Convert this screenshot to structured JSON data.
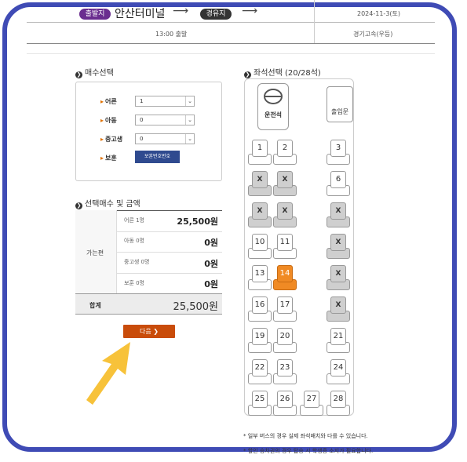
{
  "header": {
    "departure_tag": "출발지",
    "departure_name": "안산터미널",
    "via_tag": "경유지",
    "date": "2024-11-3(토)",
    "time": "13:00 출발",
    "bus_company": "경기고속(우등)"
  },
  "ticket_select": {
    "title": "매수선택",
    "rows": [
      {
        "label": "어른",
        "value": "1"
      },
      {
        "label": "아동",
        "value": "0"
      },
      {
        "label": "중고생",
        "value": "0"
      }
    ],
    "veteran_label": "보훈",
    "veteran_button": "보훈번호번호"
  },
  "summary": {
    "title": "선택매수 및 금액",
    "group_label": "가는편",
    "lines": [
      {
        "label": "어른 1명",
        "amount": "25,500원"
      },
      {
        "label": "아동 0명",
        "amount": "0원"
      },
      {
        "label": "중고생 0명",
        "amount": "0원"
      },
      {
        "label": "보훈 0명",
        "amount": "0원"
      }
    ],
    "total_label": "합계",
    "total_amount": "25,500원",
    "next_button": "다음 ❯"
  },
  "seats": {
    "title": "좌석선택 (20/28석)",
    "driver_label": "운전석",
    "door_label": "출입문",
    "taken_mark": "X",
    "notes": [
      "* 일부 버스의 경우 실제 좌석배치와 다를 수 있습니다.",
      "* 할인 승차권의 경우 탑승 시 학생증 소지가 필요합니다."
    ],
    "layout": [
      {
        "id": "1",
        "state": "free"
      },
      {
        "id": "2",
        "state": "free"
      },
      {
        "id": "3",
        "state": "free"
      },
      {
        "id": "4",
        "state": "taken"
      },
      {
        "id": "5",
        "state": "taken"
      },
      {
        "id": "6",
        "state": "free"
      },
      {
        "id": "7",
        "state": "taken"
      },
      {
        "id": "8",
        "state": "taken"
      },
      {
        "id": "9",
        "state": "taken"
      },
      {
        "id": "10",
        "state": "free"
      },
      {
        "id": "11",
        "state": "free"
      },
      {
        "id": "12",
        "state": "taken"
      },
      {
        "id": "13",
        "state": "free"
      },
      {
        "id": "14",
        "state": "selected"
      },
      {
        "id": "15",
        "state": "taken"
      },
      {
        "id": "16",
        "state": "free"
      },
      {
        "id": "17",
        "state": "free"
      },
      {
        "id": "18",
        "state": "taken"
      },
      {
        "id": "19",
        "state": "free"
      },
      {
        "id": "20",
        "state": "free"
      },
      {
        "id": "21",
        "state": "free"
      },
      {
        "id": "22",
        "state": "free"
      },
      {
        "id": "23",
        "state": "free"
      },
      {
        "id": "24",
        "state": "free"
      },
      {
        "id": "25",
        "state": "free"
      },
      {
        "id": "26",
        "state": "free"
      },
      {
        "id": "27",
        "state": "free"
      },
      {
        "id": "28",
        "state": "free"
      }
    ]
  },
  "colors": {
    "frame": "#3f4bb5",
    "selected": "#f08a24",
    "next": "#c94c0a",
    "arrow": "#f7c23a"
  }
}
